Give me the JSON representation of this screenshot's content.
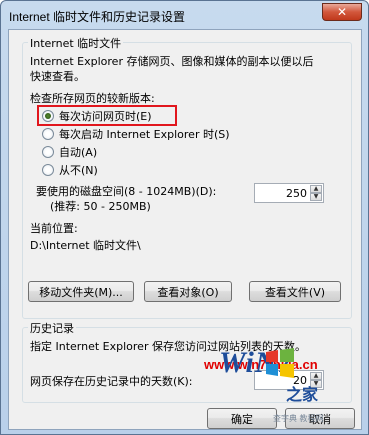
{
  "window": {
    "title": "Internet 临时文件和历史记录设置",
    "close_glyph": "✕"
  },
  "temp_files": {
    "group_label": "Internet 临时文件",
    "description_line1": "Internet Explorer 存储网页、图像和媒体的副本以便以后",
    "description_line2": "快速查看。",
    "check_label": "检查所存网页的较新版本:",
    "options": [
      {
        "label": "每次访问网页时(E)",
        "checked": true
      },
      {
        "label": "每次启动 Internet Explorer 时(S)",
        "checked": false
      },
      {
        "label": "自动(A)",
        "checked": false
      },
      {
        "label": "从不(N)",
        "checked": false
      }
    ],
    "disk_space_label_line1": "要使用的磁盘空间(8 - 1024MB)(D):",
    "disk_space_label_line2": "(推荐: 50 - 250MB)",
    "disk_space_value": "250",
    "location_label": "当前位置:",
    "location_path": "D:\\Internet 临时文件\\",
    "buttons": {
      "move_folder": "移动文件夹(M)...",
      "view_objects": "查看对象(O)",
      "view_files": "查看文件(V)"
    }
  },
  "history": {
    "group_label": "历史记录",
    "description": "指定 Internet Explorer 保存您访问过网站列表的天数。",
    "days_label": "网页保存在历史记录中的天数(K):",
    "days_value": "20"
  },
  "footer": {
    "ok_label": "确定",
    "cancel_label": "取消"
  },
  "watermark": {
    "url": "www.win7zhijia.cn",
    "logo_text": "WiN7",
    "logo_sub": "之家",
    "footer_url": "查字典 教程网"
  }
}
